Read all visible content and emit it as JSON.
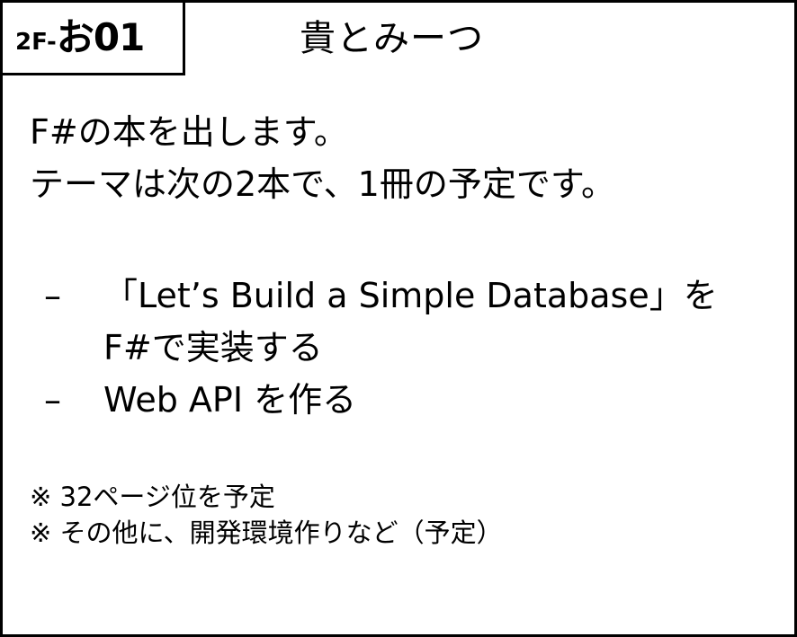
{
  "header": {
    "booth_prefix": "2F-",
    "booth_number": "お01",
    "circle_name": "貴とみーつ"
  },
  "intro": {
    "line1": "F#の本を出します。",
    "line2": "テーマは次の2本で、1冊の予定です。"
  },
  "bullets": [
    {
      "dash": "–",
      "line1": "「Let’s Build a Simple Database」を",
      "line2": "F#で実装する"
    },
    {
      "dash": "–",
      "line1": "Web API を作る"
    }
  ],
  "notes": [
    "※ 32ページ位を予定",
    "※ その他に、開発環境作りなど（予定）"
  ]
}
